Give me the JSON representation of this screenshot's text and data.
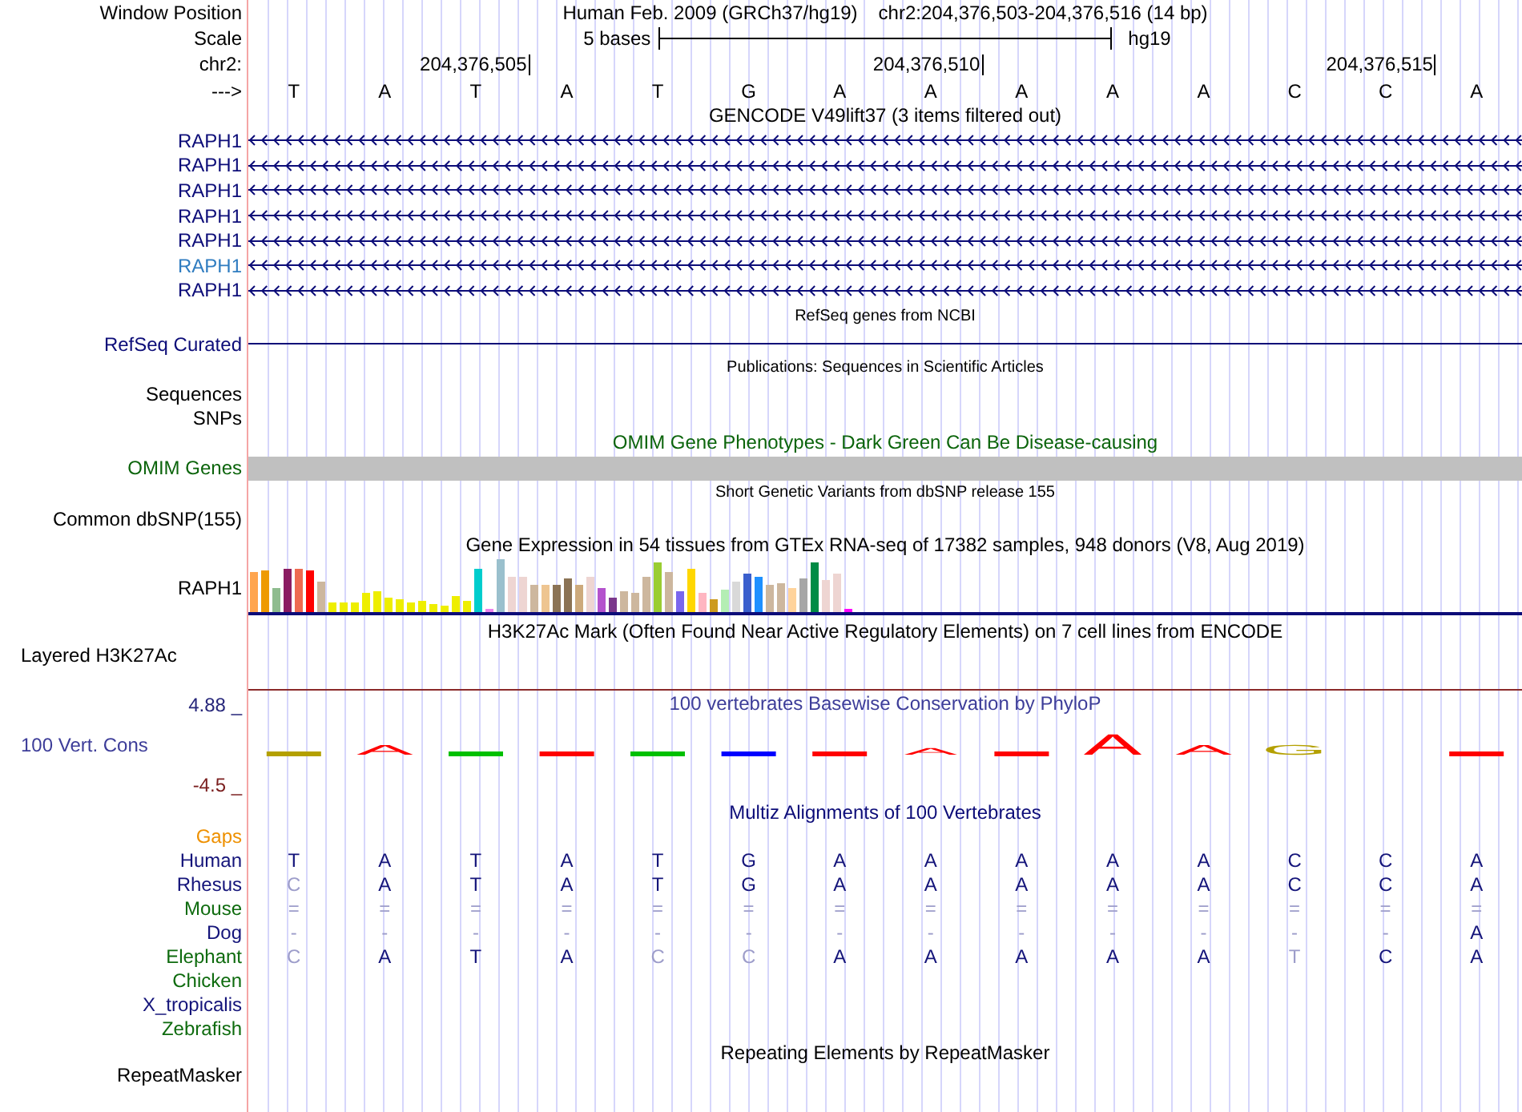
{
  "header": {
    "label": "Window Position",
    "assembly": "Human Feb. 2009 (GRCh37/hg19)",
    "position": "chr2:204,376,503-204,376,516 (14 bp)"
  },
  "scale": {
    "label": "Scale",
    "text": "5 bases",
    "database": "hg19"
  },
  "ruler": {
    "label": "chr2:",
    "ticks": [
      "204,376,505",
      "204,376,510",
      "204,376,515"
    ]
  },
  "sequence": {
    "label": "--->",
    "bases": [
      "T",
      "A",
      "T",
      "A",
      "T",
      "G",
      "A",
      "A",
      "A",
      "A",
      "A",
      "C",
      "C",
      "A"
    ]
  },
  "tracks": [
    {
      "kind": "genes",
      "title": "GENCODE V49lift37 (3 items filtered out)",
      "items": [
        {
          "label": "RAPH1",
          "color": "#0c0c78"
        },
        {
          "label": "RAPH1",
          "color": "#0c0c78"
        },
        {
          "label": "RAPH1",
          "color": "#0c0c78"
        },
        {
          "label": "RAPH1",
          "color": "#0c0c78"
        },
        {
          "label": "RAPH1",
          "color": "#0c0c78"
        },
        {
          "label": "RAPH1",
          "color": "#2f7cc0"
        },
        {
          "label": "RAPH1",
          "color": "#0c0c78"
        }
      ]
    },
    {
      "kind": "refseq",
      "title": "RefSeq genes from NCBI",
      "labels": [
        "RefSeq Curated"
      ]
    },
    {
      "kind": "publications",
      "title": "Publications: Sequences in Scientific Articles",
      "labels": [
        "Sequences",
        "SNPs"
      ]
    },
    {
      "kind": "omim",
      "title": "OMIM Gene Phenotypes - Dark Green Can Be Disease-causing",
      "labels": [
        "OMIM Genes"
      ]
    },
    {
      "kind": "dbsnp",
      "title": "Short Genetic Variants from dbSNP release 155",
      "labels": [
        "Common dbSNP(155)"
      ]
    },
    {
      "kind": "expression",
      "title": "Gene Expression in 54 tissues from GTEx RNA-seq of 17382 samples, 948 donors (V8, Aug 2019)",
      "labels": [
        "RAPH1"
      ],
      "bars": [
        {
          "color": "#ffa54f"
        },
        {
          "color": "#ee9a00"
        },
        {
          "color": "#8fbc8f"
        },
        {
          "color": "#8b1c62"
        },
        {
          "color": "#ee6a50"
        },
        {
          "color": "#ff0000"
        },
        {
          "color": "#cdb79e"
        },
        {
          "color": "#eeee00"
        },
        {
          "color": "#eeee00"
        },
        {
          "color": "#eeee00"
        },
        {
          "color": "#eeee00"
        },
        {
          "color": "#eeee00"
        },
        {
          "color": "#eeee00"
        },
        {
          "color": "#eeee00"
        },
        {
          "color": "#eeee00"
        },
        {
          "color": "#eeee00"
        },
        {
          "color": "#eeee00"
        },
        {
          "color": "#eeee00"
        },
        {
          "color": "#eeee00"
        },
        {
          "color": "#eeee00"
        },
        {
          "color": "#00cdcd"
        },
        {
          "color": "#ee82ee"
        },
        {
          "color": "#9ac0cd"
        },
        {
          "color": "#eed5d2"
        },
        {
          "color": "#eed5d2"
        },
        {
          "color": "#cdb79e"
        },
        {
          "color": "#eec591"
        },
        {
          "color": "#8b7355"
        },
        {
          "color": "#8b7355"
        },
        {
          "color": "#cdaa7d"
        },
        {
          "color": "#eed5d2"
        },
        {
          "color": "#b452cd"
        },
        {
          "color": "#7a378b"
        },
        {
          "color": "#cdb79e"
        },
        {
          "color": "#cdb79e"
        },
        {
          "color": "#cdb79e"
        },
        {
          "color": "#9acd32"
        },
        {
          "color": "#cdb79e"
        },
        {
          "color": "#7a67ee"
        },
        {
          "color": "#ffd700"
        },
        {
          "color": "#ffb6c1"
        },
        {
          "color": "#cd9b1d"
        },
        {
          "color": "#b4eeb4"
        },
        {
          "color": "#d9d9d9"
        },
        {
          "color": "#3a5fcd"
        },
        {
          "color": "#1e90ff"
        },
        {
          "color": "#cdb79e"
        },
        {
          "color": "#cdb79e"
        },
        {
          "color": "#ffd39b"
        },
        {
          "color": "#a6a6a6"
        },
        {
          "color": "#008b45"
        },
        {
          "color": "#eed5d2"
        },
        {
          "color": "#eed5d2"
        },
        {
          "color": "#ff00ff"
        }
      ]
    },
    {
      "kind": "signal",
      "title": "H3K27Ac Mark (Often Found Near Active Regulatory Elements) on 7 cell lines from ENCODE",
      "labels": [
        "Layered H3K27Ac"
      ]
    },
    {
      "kind": "conservation",
      "title": "100 vertebrates Basewise Conservation by PhyloP",
      "labels": [
        "100 Vert. Cons"
      ],
      "axis_max": "4.88 _",
      "axis_min": "-4.5 _",
      "logo": [
        {
          "kind": "flat",
          "color": "#b4a000"
        },
        {
          "kind": "medium",
          "base": "A",
          "color": "#ff0000"
        },
        {
          "kind": "flat",
          "color": "#00c000"
        },
        {
          "kind": "flat",
          "color": "#ff0000"
        },
        {
          "kind": "flat",
          "color": "#00c000"
        },
        {
          "kind": "flat",
          "color": "#0000ff"
        },
        {
          "kind": "flat",
          "color": "#ff0000"
        },
        {
          "kind": "small",
          "base": "A",
          "color": "#ff0000"
        },
        {
          "kind": "flat",
          "color": "#ff0000"
        },
        {
          "kind": "tall",
          "base": "A",
          "color": "#ff0000"
        },
        {
          "kind": "medium",
          "base": "A",
          "color": "#ff0000"
        },
        {
          "kind": "medium",
          "base": "G",
          "color": "#b4a000"
        },
        {
          "kind": "blank"
        },
        {
          "kind": "flat",
          "color": "#ff0000"
        }
      ]
    },
    {
      "kind": "alignment",
      "title": "Multiz Alignments of 100 Vertebrates",
      "gaps_label": "Gaps",
      "species": [
        {
          "name": "Human",
          "color": "#14147a",
          "bases": [
            {
              "base": "T",
              "dimmed": false
            },
            {
              "base": "A",
              "dimmed": false
            },
            {
              "base": "T",
              "dimmed": false
            },
            {
              "base": "A",
              "dimmed": false
            },
            {
              "base": "T",
              "dimmed": false
            },
            {
              "base": "G",
              "dimmed": false
            },
            {
              "base": "A",
              "dimmed": false
            },
            {
              "base": "A",
              "dimmed": false
            },
            {
              "base": "A",
              "dimmed": false
            },
            {
              "base": "A",
              "dimmed": false
            },
            {
              "base": "A",
              "dimmed": false
            },
            {
              "base": "C",
              "dimmed": false
            },
            {
              "base": "C",
              "dimmed": false
            },
            {
              "base": "A",
              "dimmed": false
            }
          ]
        },
        {
          "name": "Rhesus",
          "color": "#14147a",
          "bases": [
            {
              "base": "C",
              "dimmed": true
            },
            {
              "base": "A",
              "dimmed": false
            },
            {
              "base": "T",
              "dimmed": false
            },
            {
              "base": "A",
              "dimmed": false
            },
            {
              "base": "T",
              "dimmed": false
            },
            {
              "base": "G",
              "dimmed": false
            },
            {
              "base": "A",
              "dimmed": false
            },
            {
              "base": "A",
              "dimmed": false
            },
            {
              "base": "A",
              "dimmed": false
            },
            {
              "base": "A",
              "dimmed": false
            },
            {
              "base": "A",
              "dimmed": false
            },
            {
              "base": "C",
              "dimmed": false
            },
            {
              "base": "C",
              "dimmed": false
            },
            {
              "base": "A",
              "dimmed": false
            }
          ]
        },
        {
          "name": "Mouse",
          "color": "#0e6b0e",
          "bases": [
            {
              "base": "=",
              "dimmed": true
            },
            {
              "base": "=",
              "dimmed": true
            },
            {
              "base": "=",
              "dimmed": true
            },
            {
              "base": "=",
              "dimmed": true
            },
            {
              "base": "=",
              "dimmed": true
            },
            {
              "base": "=",
              "dimmed": true
            },
            {
              "base": "=",
              "dimmed": true
            },
            {
              "base": "=",
              "dimmed": true
            },
            {
              "base": "=",
              "dimmed": true
            },
            {
              "base": "=",
              "dimmed": true
            },
            {
              "base": "=",
              "dimmed": true
            },
            {
              "base": "=",
              "dimmed": true
            },
            {
              "base": "=",
              "dimmed": true
            },
            {
              "base": "=",
              "dimmed": true
            }
          ]
        },
        {
          "name": "Dog",
          "color": "#14147a",
          "bases": [
            {
              "base": "-",
              "dimmed": true
            },
            {
              "base": "-",
              "dimmed": true
            },
            {
              "base": "-",
              "dimmed": true
            },
            {
              "base": "-",
              "dimmed": true
            },
            {
              "base": "-",
              "dimmed": true
            },
            {
              "base": "-",
              "dimmed": true
            },
            {
              "base": "-",
              "dimmed": true
            },
            {
              "base": "-",
              "dimmed": true
            },
            {
              "base": "-",
              "dimmed": true
            },
            {
              "base": "-",
              "dimmed": true
            },
            {
              "base": "-",
              "dimmed": true
            },
            {
              "base": "-",
              "dimmed": true
            },
            {
              "base": "-",
              "dimmed": true
            },
            {
              "base": "A",
              "dimmed": false
            }
          ]
        },
        {
          "name": "Elephant",
          "color": "#0e6b0e",
          "bases": [
            {
              "base": "C",
              "dimmed": true
            },
            {
              "base": "A",
              "dimmed": false
            },
            {
              "base": "T",
              "dimmed": false
            },
            {
              "base": "A",
              "dimmed": false
            },
            {
              "base": "C",
              "dimmed": true
            },
            {
              "base": "C",
              "dimmed": true
            },
            {
              "base": "A",
              "dimmed": false
            },
            {
              "base": "A",
              "dimmed": false
            },
            {
              "base": "A",
              "dimmed": false
            },
            {
              "base": "A",
              "dimmed": false
            },
            {
              "base": "A",
              "dimmed": false
            },
            {
              "base": "T",
              "dimmed": true
            },
            {
              "base": "C",
              "dimmed": false
            },
            {
              "base": "A",
              "dimmed": false
            }
          ]
        },
        {
          "name": "Chicken",
          "color": "#0e6b0e"
        },
        {
          "name": "X_tropicalis",
          "color": "#14147a"
        },
        {
          "name": "Zebrafish",
          "color": "#0e6b0e"
        }
      ]
    },
    {
      "kind": "repeats",
      "title": "Repeating Elements by RepeatMasker",
      "labels": [
        "RepeatMasker"
      ]
    }
  ]
}
